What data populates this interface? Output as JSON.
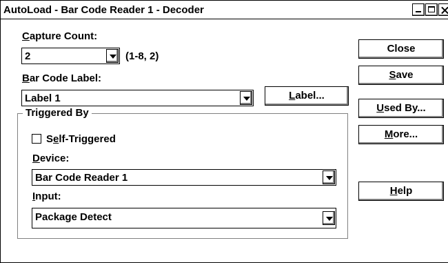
{
  "window": {
    "title": "AutoLoad - Bar Code Reader 1 - Decoder"
  },
  "capture_count": {
    "label_pre": "",
    "label_u": "C",
    "label_post": "apture Count:",
    "value": "2",
    "range_hint": "(1-8, 2)"
  },
  "bar_code_label": {
    "label_u": "B",
    "label_post": "ar Code Label:",
    "value": "Label 1",
    "button_u": "L",
    "button_post": "abel..."
  },
  "triggered_by": {
    "group_label": "Triggered By",
    "self_triggered_pre": "S",
    "self_triggered_u": "e",
    "self_triggered_post": "lf-Triggered",
    "self_triggered_checked": false,
    "device_label_u": "D",
    "device_label_post": "evice:",
    "device_value": "Bar Code Reader 1",
    "input_label_u": "I",
    "input_label_post": "nput:",
    "input_value": "Package Detect"
  },
  "buttons": {
    "close": "Close",
    "save_u": "S",
    "save_post": "ave",
    "used_by_u": "U",
    "used_by_post": "sed By...",
    "more_u": "M",
    "more_post": "ore...",
    "help_u": "H",
    "help_post": "elp"
  }
}
